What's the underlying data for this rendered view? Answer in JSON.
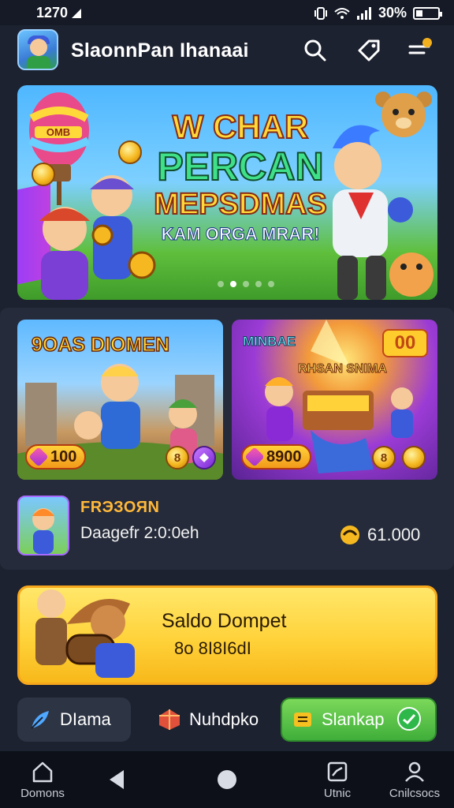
{
  "status_bar": {
    "time": "1270",
    "battery": "30%",
    "battery_level": 0.3
  },
  "header": {
    "title": "SlaonnPan Ihanaai"
  },
  "banner": {
    "line1": "W CHAR",
    "line2": "PERCAN",
    "line3": "MEPSDMAS",
    "line4": "KAM ORGA MRAR!",
    "balloon_label": "OMB"
  },
  "cards": [
    {
      "title": "9OAS DIOMEN",
      "amount": "100",
      "coin": "8"
    },
    {
      "title_top": "MINBAE",
      "title_sub": "RHSAN SNIMA",
      "badge": "00",
      "amount": "8900",
      "coin": "8"
    }
  ],
  "reward": {
    "title": "FRЭЗОЯN",
    "date": "Daagefr 2:0:0eh",
    "amount": "61.000"
  },
  "wallet": {
    "title": "Saldo Dompet",
    "balance": "8o 8I8I6dI"
  },
  "actions": [
    {
      "label": "DIama"
    },
    {
      "label": "Nuhdpko"
    },
    {
      "label": "Slankap"
    }
  ],
  "nav": {
    "left_label": "Domons",
    "mid_label": "Utnic",
    "right_label": "Cnilcsocs"
  }
}
